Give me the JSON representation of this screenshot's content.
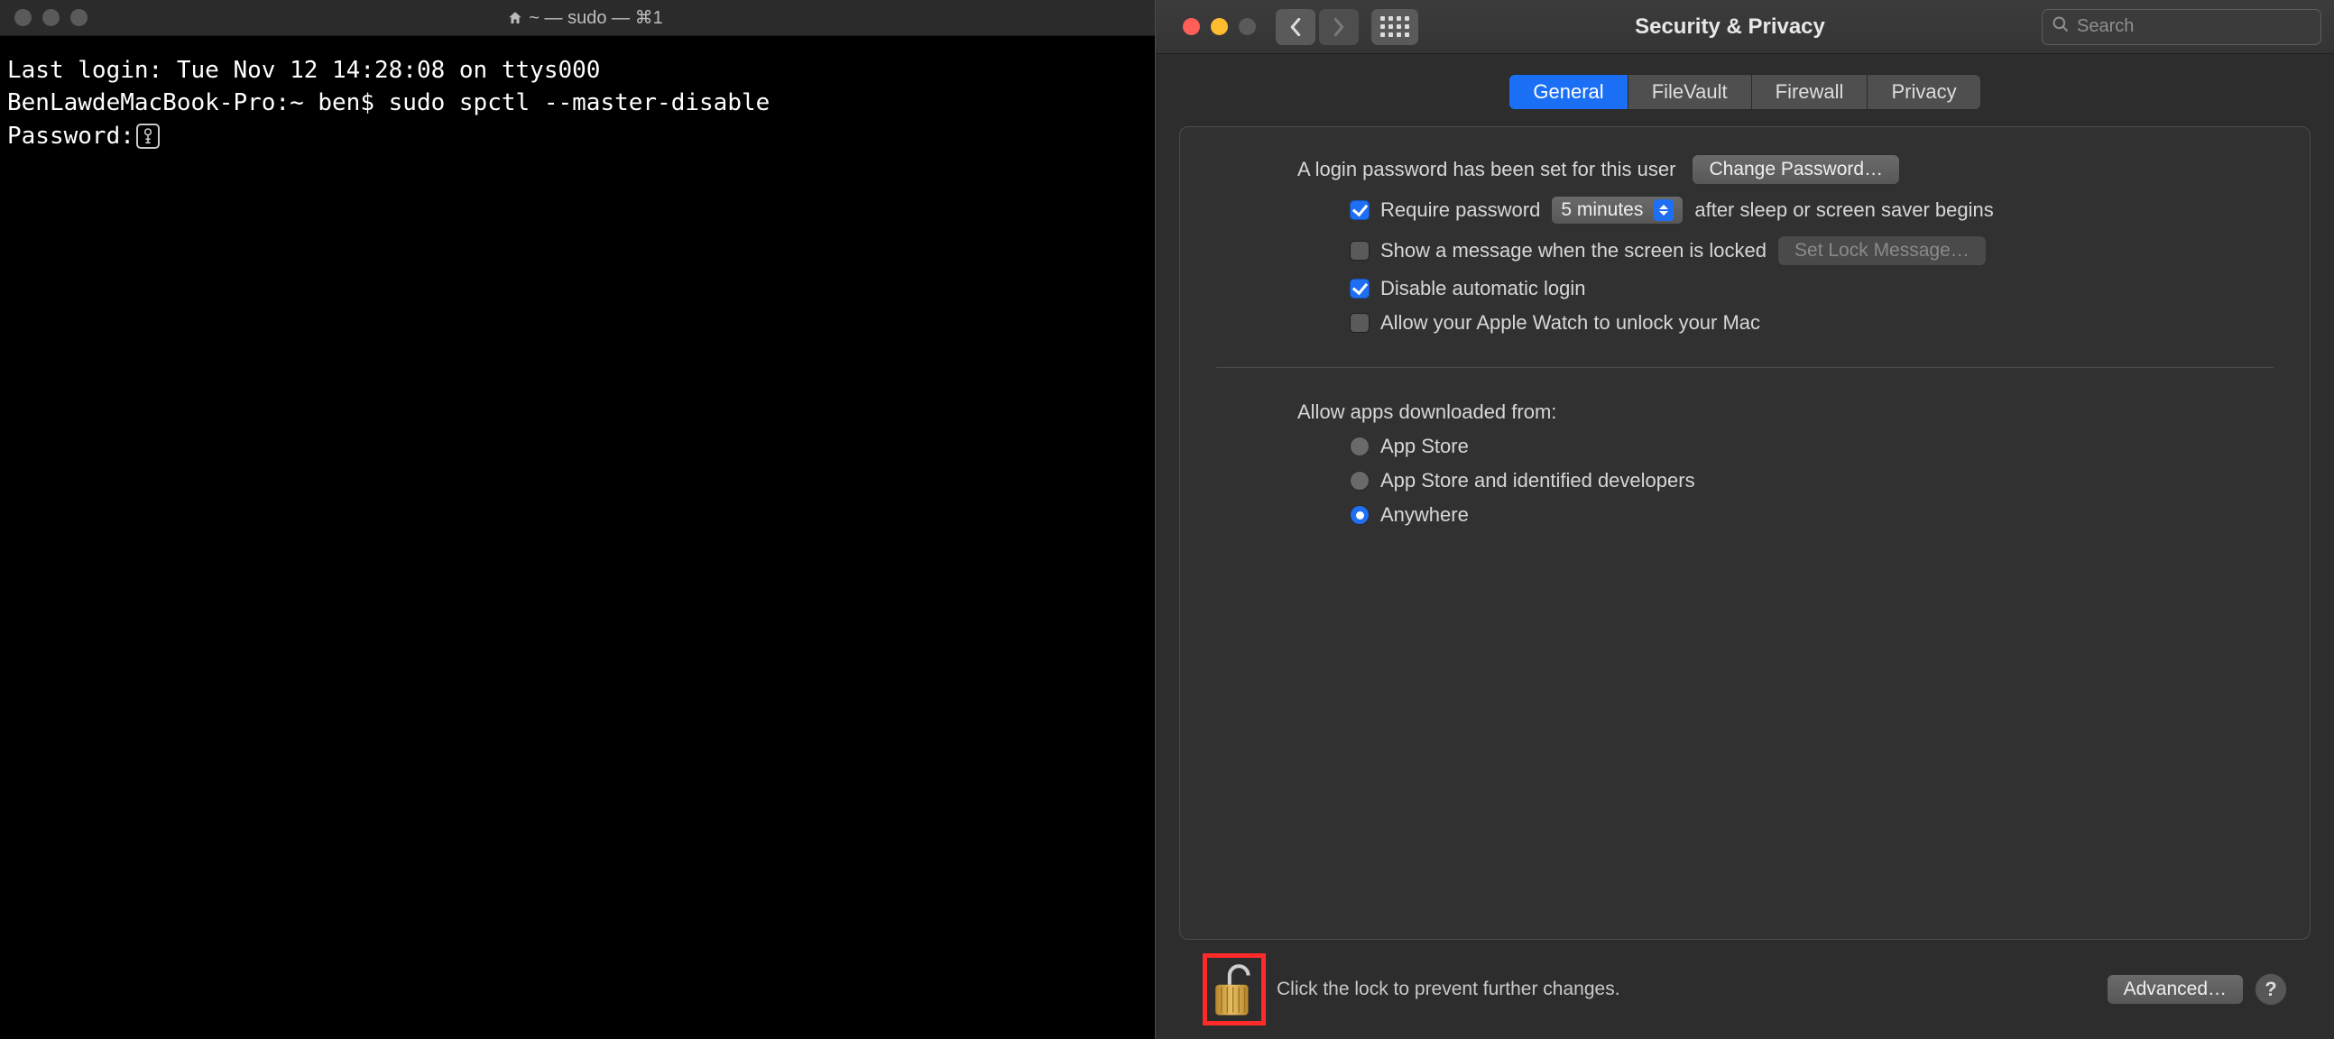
{
  "terminal": {
    "title": "~ — sudo — ⌘1",
    "line1": "Last login: Tue Nov 12 14:28:08 on ttys000",
    "line2": "BenLawdeMacBook-Pro:~ ben$ sudo spctl --master-disable",
    "line3_label": "Password:"
  },
  "prefs": {
    "title": "Security & Privacy",
    "search_placeholder": "Search",
    "tabs": {
      "general": "General",
      "filevault": "FileVault",
      "firewall": "Firewall",
      "privacy": "Privacy"
    },
    "login_password_text": "A login password has been set for this user",
    "change_password_btn": "Change Password…",
    "require_password_label": "Require password",
    "require_password_delay": "5 minutes",
    "require_password_suffix": "after sleep or screen saver begins",
    "show_message_label": "Show a message when the screen is locked",
    "set_lock_message_btn": "Set Lock Message…",
    "disable_auto_login_label": "Disable automatic login",
    "apple_watch_label": "Allow your Apple Watch to unlock your Mac",
    "allow_apps_header": "Allow apps downloaded from:",
    "radio_app_store": "App Store",
    "radio_identified": "App Store and identified developers",
    "radio_anywhere": "Anywhere",
    "lock_text": "Click the lock to prevent further changes.",
    "advanced_btn": "Advanced…",
    "help": "?"
  }
}
